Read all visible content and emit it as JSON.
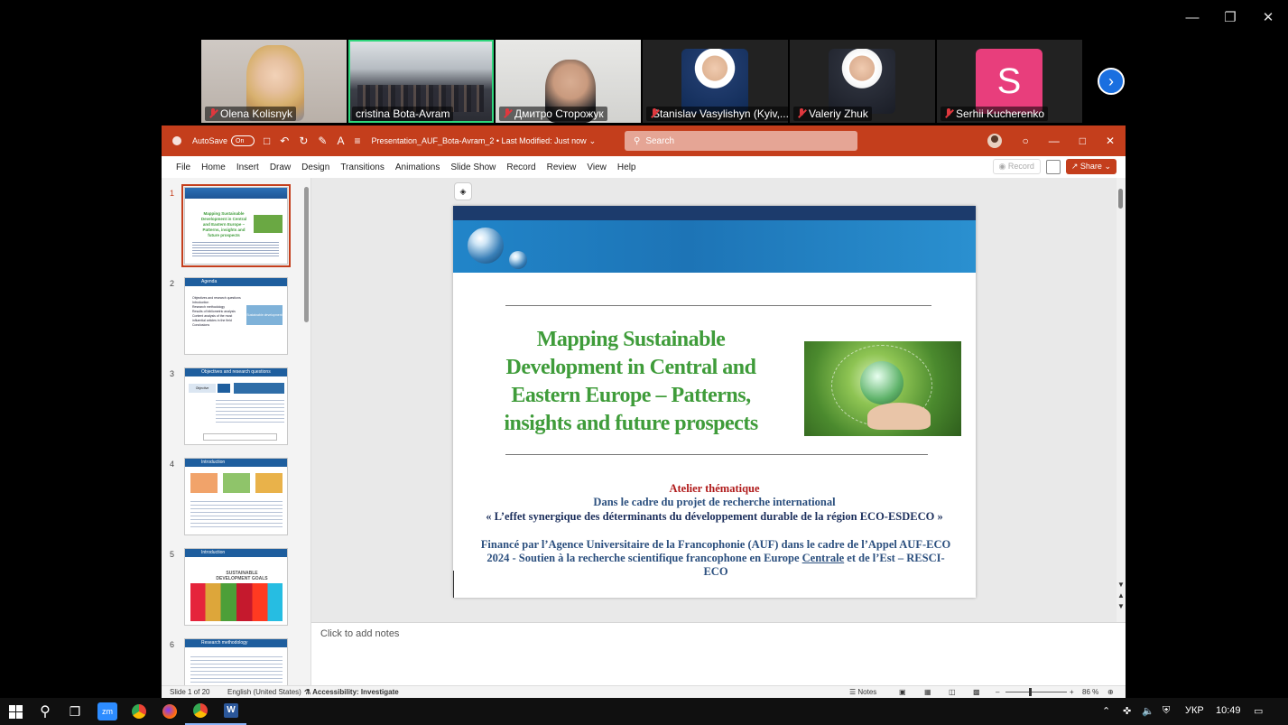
{
  "participants": [
    {
      "name": "Olena Kolisnyk",
      "muted": true
    },
    {
      "name": "cristina Bota-Avram",
      "muted": false,
      "active": true
    },
    {
      "name": "Дмитро Сторожук",
      "muted": true
    },
    {
      "name": "Stanislav Vasylishyn (Kyiv,...",
      "muted": true
    },
    {
      "name": "Valeriy Zhuk",
      "muted": true
    },
    {
      "name": "Serhii Kucherenko",
      "muted": true,
      "initial": "S",
      "avatar_color": "#e83e7c"
    }
  ],
  "ppt": {
    "autosave_label": "AutoSave",
    "autosave_state": "On",
    "doc_title": "Presentation_AUF_Bota-Avram_2 • Last Modified: Just now",
    "search_placeholder": "Search",
    "menu": [
      "File",
      "Home",
      "Insert",
      "Draw",
      "Design",
      "Transitions",
      "Animations",
      "Slide Show",
      "Record",
      "Review",
      "View",
      "Help"
    ],
    "record_label": "Record",
    "share_label": "Share",
    "accent_color": "#c43e1c",
    "thumbnails": [
      {
        "num": "1",
        "title": "Mapping Sustainable Development in Central and Eastern Europe – Patterns, insights and future prospects"
      },
      {
        "num": "2",
        "title": "Agenda",
        "items": [
          "Objectives and research questions",
          "Introduction",
          "Research methodology",
          "Results of bibliometric analysis",
          "Content analysis of the most influential articles in the field",
          "Conclusions"
        ],
        "image_label": "Sustainable development"
      },
      {
        "num": "3",
        "title": "Objectives and research questions",
        "objective_label": "Objective"
      },
      {
        "num": "4",
        "title": "Introduction"
      },
      {
        "num": "5",
        "title": "Introduction",
        "sdg_label": "SUSTAINABLE DEVELOPMENT GOALS"
      },
      {
        "num": "6",
        "title": "Research methodology"
      }
    ],
    "slide": {
      "title": "Mapping Sustainable Development in Central and Eastern Europe – Patterns, insights and future prospects",
      "line1": "Atelier thématique",
      "line2": "Dans le cadre du projet de recherche international",
      "line3": "« L’effet synergique des déterminants du développement durable de la région ECO-ESDECO »",
      "funding_a": "Financé par l’Agence Universitaire de la Francophonie (AUF) dans le cadre de l’Appel AUF-ECO 2024 - Soutien à la recherche scientifique francophone en Europe ",
      "funding_u": "Centrale",
      "funding_b": " et de l’Est – RESCI-ECO"
    },
    "notes_placeholder": "Click to add notes",
    "status": {
      "slide_info": "Slide 1 of 20",
      "language": "English (United States)",
      "accessibility": "Accessibility: Investigate",
      "notes_label": "Notes",
      "zoom": "86 %",
      "zoom_level": 0.86
    }
  },
  "taskbar": {
    "zoom_label": "zm",
    "word_label": "W",
    "lang": "УКР",
    "time": "10:49"
  }
}
